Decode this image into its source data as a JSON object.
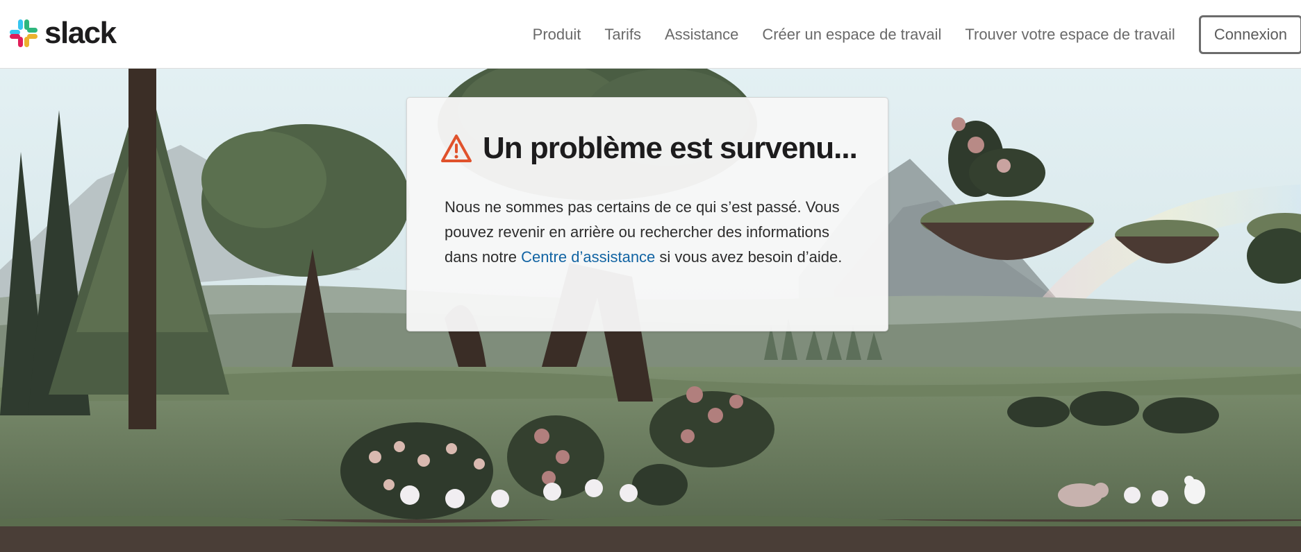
{
  "brand": {
    "wordmark": "slack",
    "colors": {
      "aubergine": "#36c5f0",
      "green": "#2eb67d",
      "yellow": "#ecb22e",
      "red": "#e01e5a"
    }
  },
  "nav": {
    "items": [
      {
        "label": "Produit"
      },
      {
        "label": "Tarifs"
      },
      {
        "label": "Assistance"
      },
      {
        "label": "Créer un espace de travail"
      },
      {
        "label": "Trouver votre espace de travail"
      }
    ],
    "login_label": "Connexion"
  },
  "error": {
    "icon": "warning-triangle-icon",
    "icon_color": "#e0522c",
    "title": "Un problème est survenu...",
    "message_before": "Nous ne sommes pas certains de ce qui s’est passé. Vous pouvez revenir en arrière ou rechercher des informations dans notre ",
    "link_label": "Centre d’assistance",
    "message_after": " si vous avez besoin d’aide."
  }
}
